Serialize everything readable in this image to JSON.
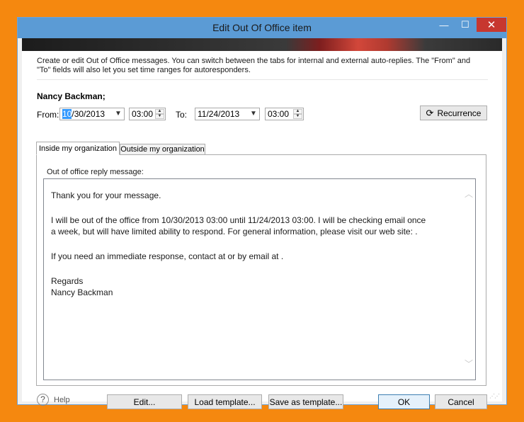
{
  "window": {
    "title": "Edit Out Of Office item",
    "minimize_glyph": "—",
    "maximize_glyph": "☐",
    "close_glyph": "✕"
  },
  "description": "Create or edit Out of Office messages. You can switch between the tabs for internal and external auto-replies. The \"From\" and \"To\" fields will also let you set time ranges for autoresponders.",
  "user_name": "Nancy Backman;",
  "from": {
    "label": "From:",
    "date_selected_part": "10",
    "date_rest": "/30/2013",
    "time": "03:00"
  },
  "to": {
    "label": "To:",
    "date": "11/24/2013",
    "time": "03:00"
  },
  "recurrence_button": "Recurrence",
  "tabs": [
    {
      "label": "Inside my organization",
      "active": true
    },
    {
      "label": "Outside my organization",
      "active": false
    }
  ],
  "message_label": "Out of office reply message:",
  "message_lines": [
    "Thank you for your message.",
    "I will be out of the office from 10/30/2013 03:00 until 11/24/2013 03:00. I will be checking email once",
    "a week, but will have limited ability to respond. For general information, please visit our web site: .",
    "If you need an immediate response, contact  at or by email at .",
    "Regards",
    "Nancy Backman"
  ],
  "footer": {
    "help_label": "Help",
    "edit_button": "Edit...",
    "load_template_button": "Load template...",
    "save_template_button": "Save as template...",
    "ok_button": "OK",
    "cancel_button": "Cancel"
  },
  "colors": {
    "background": "#f5880f",
    "titlebar": "#5b9bd5",
    "close_button": "#c7372f",
    "selection": "#3399ff"
  }
}
